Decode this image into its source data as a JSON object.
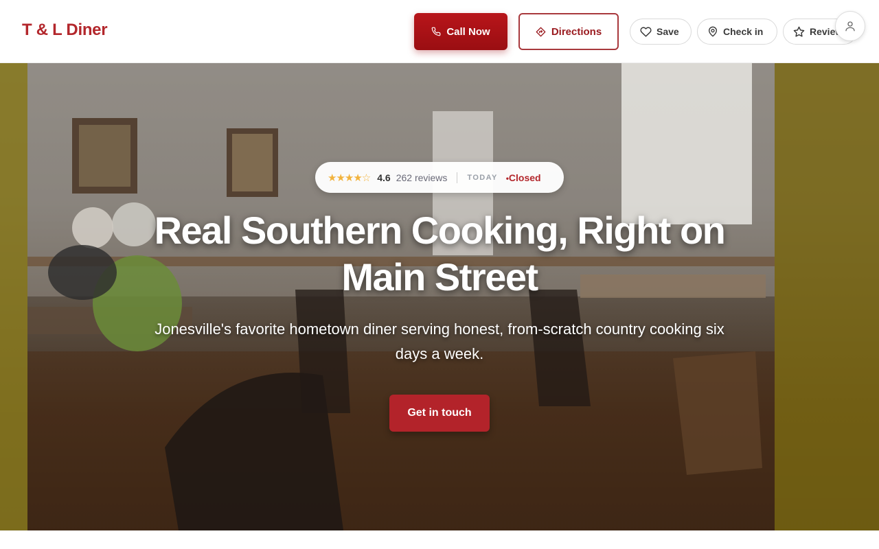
{
  "header": {
    "brand": "T & L Diner",
    "call_label": "Call Now",
    "directions_label": "Directions",
    "save_label": "Save",
    "checkin_label": "Check in",
    "review_label": "Review"
  },
  "hero": {
    "stars": "★★★★☆",
    "rating": "4.6",
    "reviews": "262 reviews",
    "today_label": "TODAY",
    "status": "Closed",
    "headline": "Real Southern Cooking, Right on Main Street",
    "subtitle": "Jonesville's favorite hometown diner serving honest, from-scratch country cooking six days a week.",
    "cta_label": "Get in touch"
  },
  "colors": {
    "brand": "#b3272c",
    "call_button": "#b8151a",
    "star": "#f2b33d"
  },
  "icons": {
    "call": "phone-icon",
    "directions": "directions-icon",
    "save": "heart-icon",
    "checkin": "location-pin-icon",
    "review": "star-icon",
    "account": "user-icon"
  }
}
